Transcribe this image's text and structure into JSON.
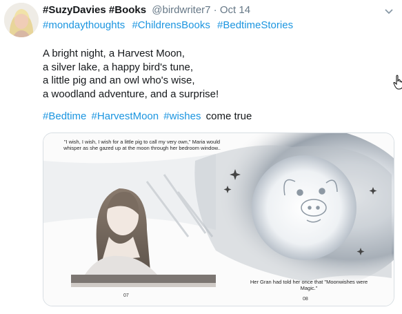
{
  "tweet": {
    "display_name": "#SuzyDavies #Books",
    "handle": "@birdwriter7",
    "separator": "·",
    "timestamp": "Oct 14",
    "top_hashtags": [
      "#mondaythoughts",
      "#ChildrensBooks",
      "#BedtimeStories"
    ],
    "lines": [
      "A bright night, a Harvest Moon,",
      "a silver lake, a happy bird's tune,",
      "a little pig and an owl who's wise,",
      "a woodland adventure, and a surprise!"
    ],
    "bottom_hashtags": [
      "#Bedtime",
      "#HarvestMoon",
      "#wishes"
    ],
    "bottom_text": "come true"
  },
  "media": {
    "caption_left": "\"I wish, I wish, I wish for a little pig to call my very own,\" Maria would whisper as she gazed up at the moon through her bedroom window..",
    "caption_right": "Her Gran had told her once that \"Moonwishes were Magic.\"",
    "page_left": "07",
    "page_right": "08"
  },
  "icons": {
    "menu": "chevron-down-icon",
    "cursor": "hand-pointer-icon"
  },
  "colors": {
    "link": "#1b95e0",
    "text": "#14171a",
    "muted": "#657786"
  }
}
